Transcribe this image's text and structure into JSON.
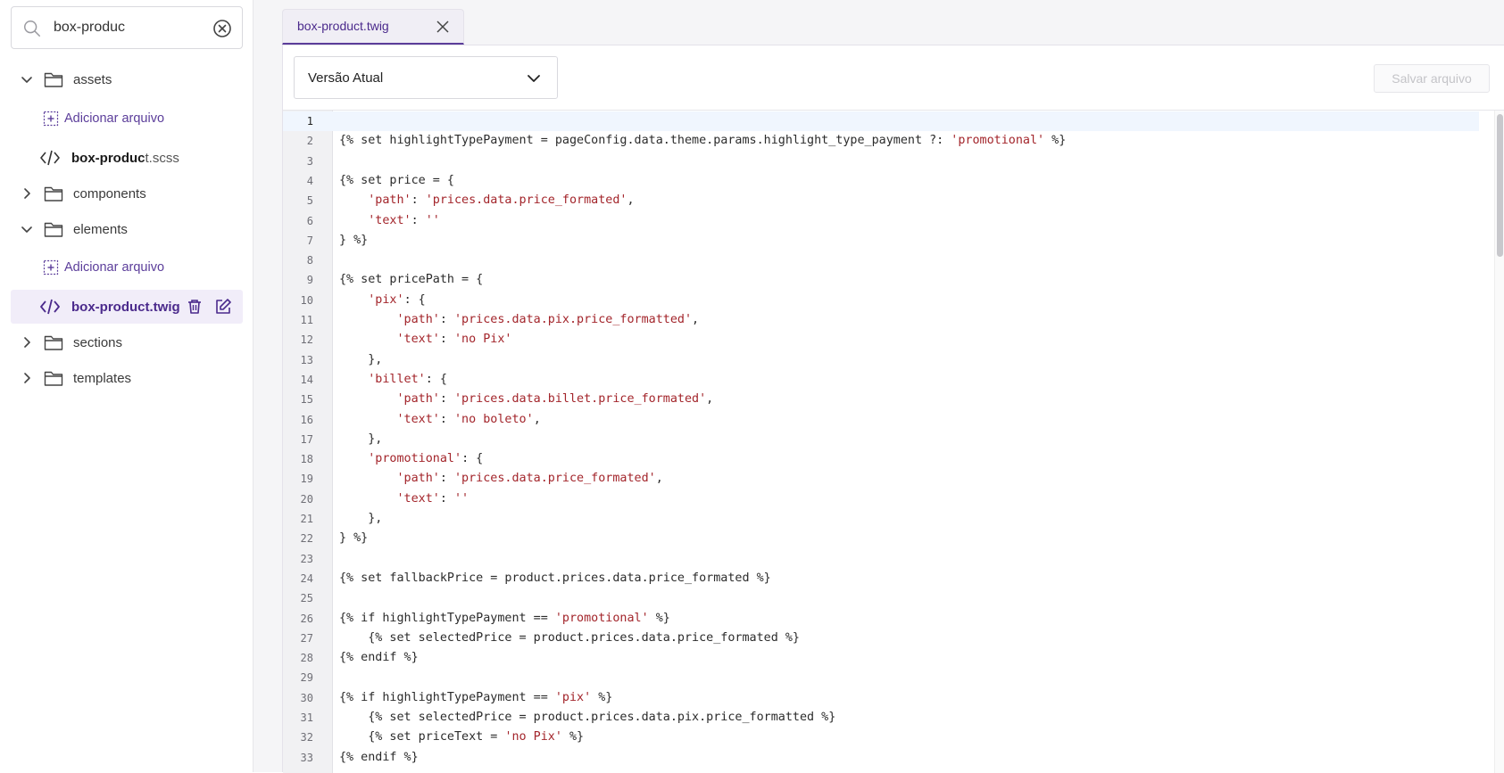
{
  "sidebar": {
    "search": {
      "value": "box-produc",
      "placeholder": ""
    },
    "tree": {
      "assets": "assets",
      "assets_add": "Adicionar arquivo",
      "assets_file_bold": "box-produc",
      "assets_file_rest": "t.scss",
      "components": "components",
      "elements": "elements",
      "elements_add": "Adicionar arquivo",
      "elements_file": "box-product.twig",
      "sections": "sections",
      "templates": "templates"
    }
  },
  "tab": {
    "label": "box-product.twig"
  },
  "toolbar": {
    "version_label": "Versão Atual",
    "save_label": "Salvar arquivo"
  },
  "editor": {
    "current_line": 1,
    "lines": [
      "",
      "{% set highlightTypePayment = pageConfig.data.theme.params.highlight_type_payment ?: 'promotional' %}",
      "",
      "{% set price = {",
      "    'path': 'prices.data.price_formated',",
      "    'text': ''",
      "} %}",
      "",
      "{% set pricePath = {",
      "    'pix': {",
      "        'path': 'prices.data.pix.price_formatted',",
      "        'text': 'no Pix'",
      "    },",
      "    'billet': {",
      "        'path': 'prices.data.billet.price_formated',",
      "        'text': 'no boleto',",
      "    },",
      "    'promotional': {",
      "        'path': 'prices.data.price_formated',",
      "        'text': ''",
      "    },",
      "} %}",
      "",
      "{% set fallbackPrice = product.prices.data.price_formated %}",
      "",
      "{% if highlightTypePayment == 'promotional' %}",
      "    {% set selectedPrice = product.prices.data.price_formated %}",
      "{% endif %}",
      "",
      "{% if highlightTypePayment == 'pix' %}",
      "    {% set selectedPrice = product.prices.data.pix.price_formatted %}",
      "    {% set priceText = 'no Pix' %}",
      "{% endif %}"
    ]
  },
  "colors": {
    "accent": "#5b3d9a",
    "string": "#a3252b",
    "active_row_bg": "#f1edf9"
  }
}
